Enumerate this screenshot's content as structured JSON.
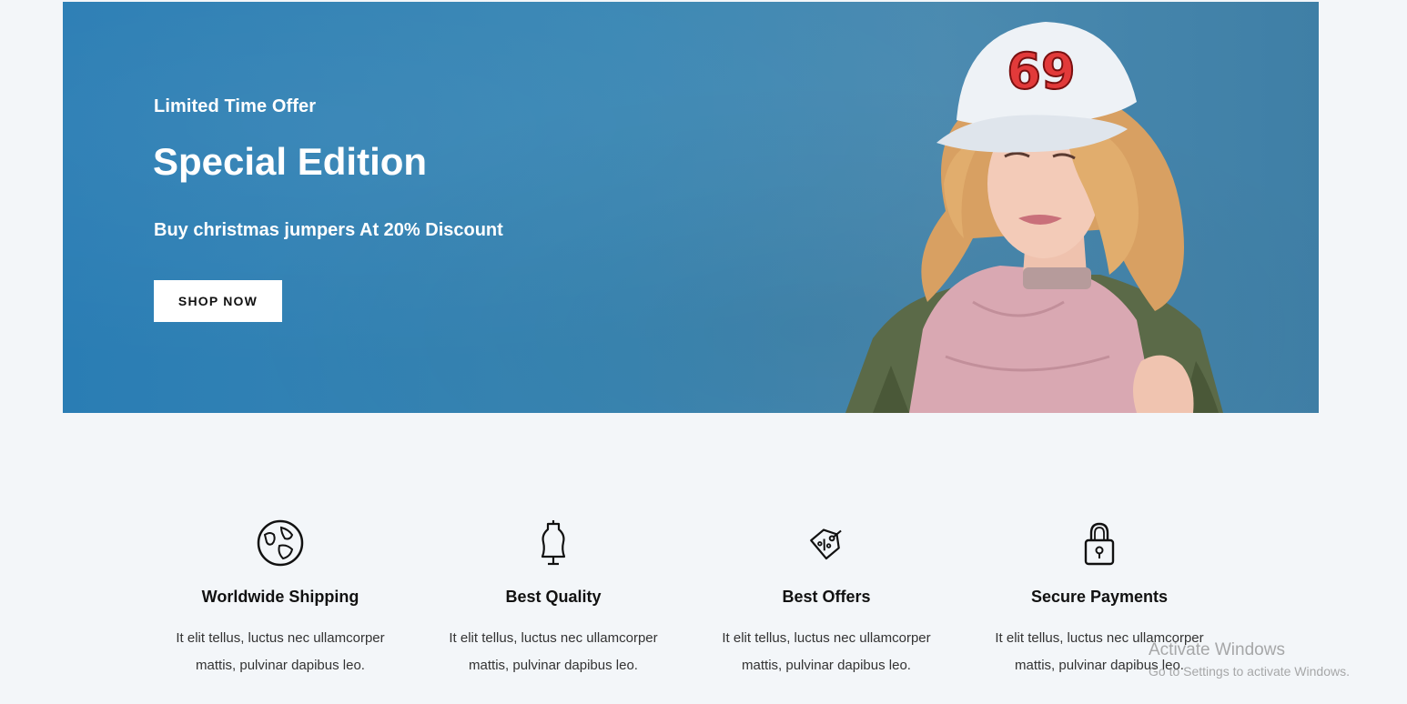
{
  "banner": {
    "kicker": "Limited Time Offer",
    "headline": "Special Edition",
    "subhead": "Buy christmas jumpers At 20% Discount",
    "cta_label": "SHOP NOW",
    "cap_number": "69",
    "background_color": "#2f83b6"
  },
  "features": [
    {
      "icon": "globe-icon",
      "title": "Worldwide Shipping",
      "desc_line1": "It elit tellus, luctus nec ullamcorper",
      "desc_line2": "mattis, pulvinar dapibus leo."
    },
    {
      "icon": "mannequin-icon",
      "title": "Best Quality",
      "desc_line1": "It elit tellus, luctus nec ullamcorper",
      "desc_line2": "mattis, pulvinar dapibus leo."
    },
    {
      "icon": "price-tag-icon",
      "title": "Best Offers",
      "desc_line1": "It elit tellus, luctus nec ullamcorper",
      "desc_line2": "mattis, pulvinar dapibus leo."
    },
    {
      "icon": "padlock-icon",
      "title": "Secure Payments",
      "desc_line1": "It elit tellus, luctus nec ullamcorper",
      "desc_line2": "mattis, pulvinar dapibus leo."
    }
  ],
  "watermark": {
    "line1": "Activate Windows",
    "line2": "Go to Settings to activate Windows."
  }
}
